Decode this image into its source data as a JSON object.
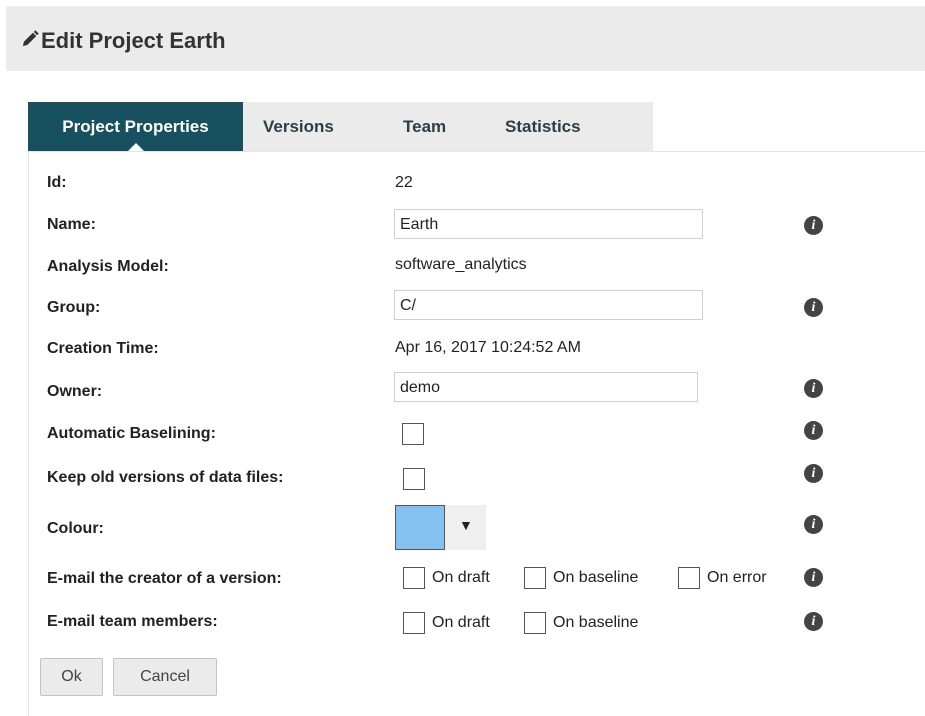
{
  "header": {
    "title": "Edit Project Earth",
    "icon": "pencil-icon"
  },
  "tabs": [
    {
      "label": "Project Properties",
      "active": true
    },
    {
      "label": "Versions",
      "active": false
    },
    {
      "label": "Team",
      "active": false
    },
    {
      "label": "Statistics",
      "active": false
    }
  ],
  "form": {
    "id": {
      "label": "Id:",
      "value": "22"
    },
    "name": {
      "label": "Name:",
      "value": "Earth"
    },
    "analysis_model": {
      "label": "Analysis Model:",
      "value": "software_analytics"
    },
    "group": {
      "label": "Group:",
      "value": "C/"
    },
    "creation_time": {
      "label": "Creation Time:",
      "value": "Apr 16, 2017 10:24:52 AM"
    },
    "owner": {
      "label": "Owner:",
      "value": "demo"
    },
    "automatic_baselining": {
      "label": "Automatic Baselining:",
      "checked": false
    },
    "keep_old_versions": {
      "label": "Keep old versions of data files:",
      "checked": false
    },
    "colour": {
      "label": "Colour:",
      "value": "#85c1f0",
      "dropdown_glyph": "▼"
    },
    "email_creator": {
      "label": "E-mail the creator of a version:",
      "options": [
        {
          "label": "On draft",
          "checked": false
        },
        {
          "label": "On baseline",
          "checked": false
        },
        {
          "label": "On error",
          "checked": false
        }
      ]
    },
    "email_team": {
      "label": "E-mail team members:",
      "options": [
        {
          "label": "On draft",
          "checked": false
        },
        {
          "label": "On baseline",
          "checked": false
        }
      ]
    },
    "info_glyph": "i"
  },
  "buttons": {
    "ok": "Ok",
    "cancel": "Cancel"
  },
  "colors": {
    "tab_active": "#17505e",
    "header_bg": "#ebebeb",
    "info_icon": "#444444"
  }
}
